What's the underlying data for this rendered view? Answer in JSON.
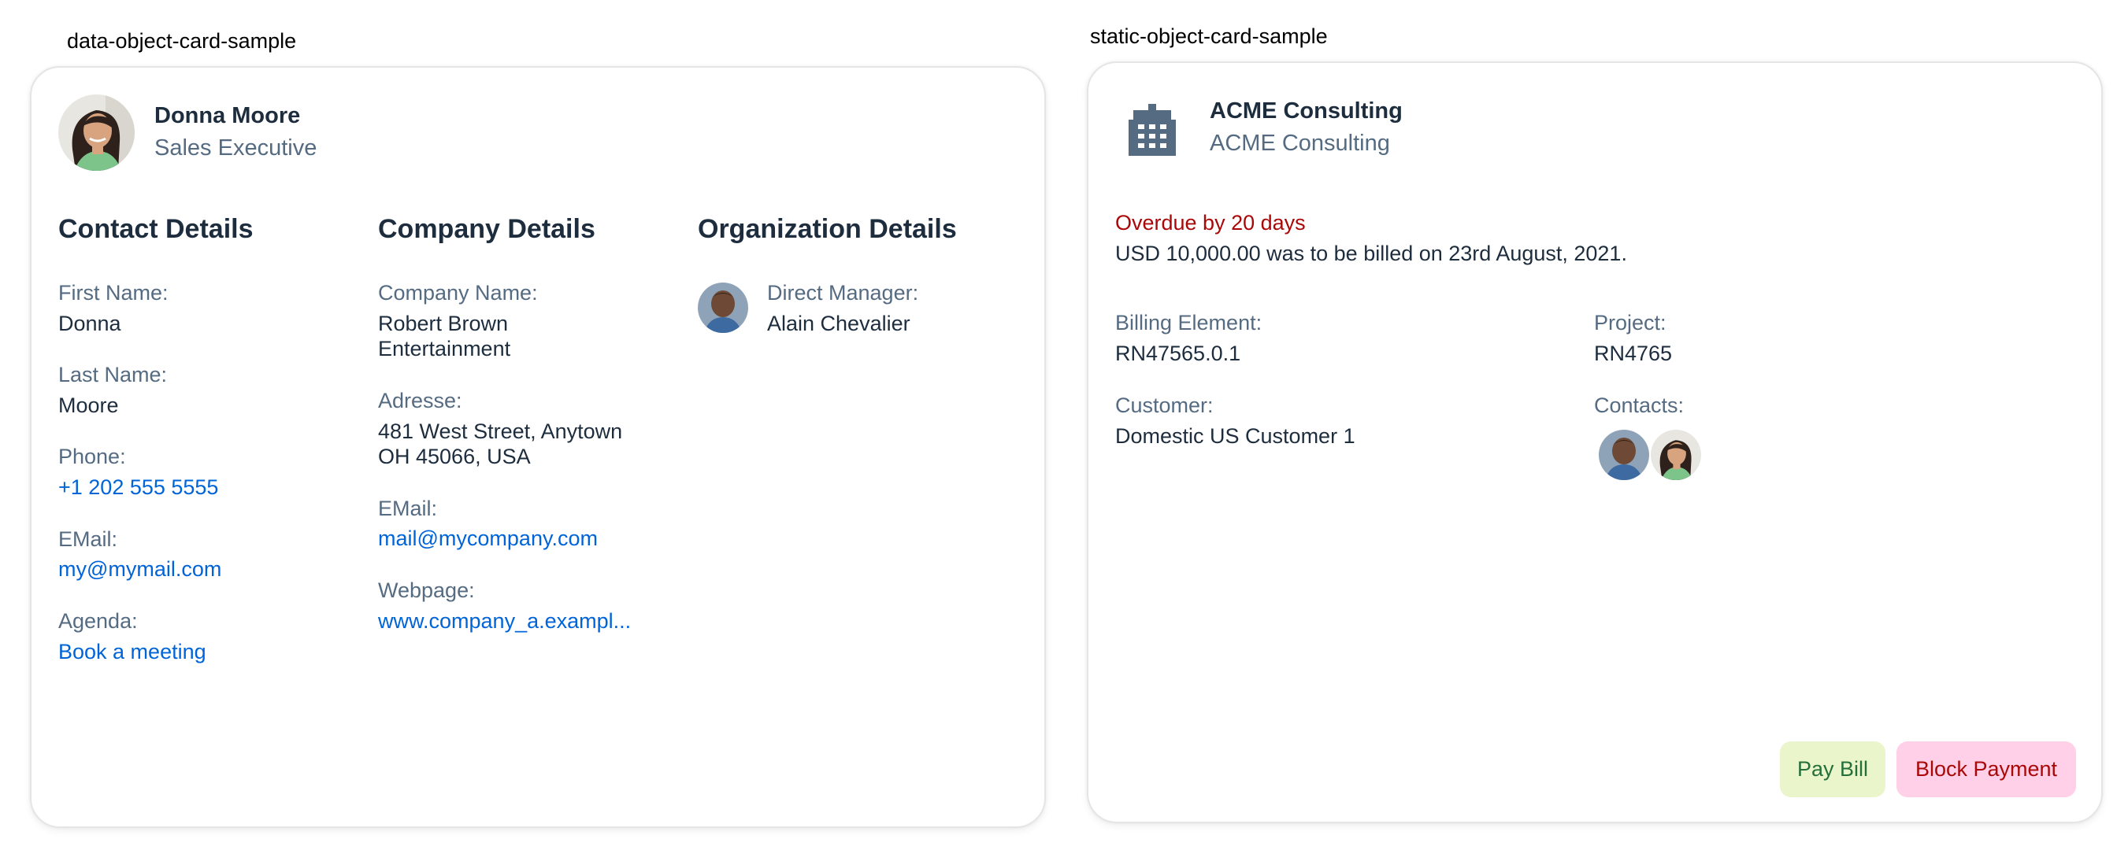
{
  "left_card": {
    "sample_label": "data-object-card-sample",
    "header": {
      "title": "Donna Moore",
      "subtitle": "Sales Executive"
    },
    "contact": {
      "heading": "Contact Details",
      "first_name_label": "First Name:",
      "first_name": "Donna",
      "last_name_label": "Last Name:",
      "last_name": "Moore",
      "phone_label": "Phone:",
      "phone": "+1 202 555 5555",
      "email_label": "EMail:",
      "email": "my@mymail.com",
      "agenda_label": "Agenda:",
      "agenda": "Book a meeting"
    },
    "company": {
      "heading": "Company Details",
      "name_label": "Company Name:",
      "name_line1": "Robert Brown",
      "name_line2": "Entertainment",
      "address_label": "Adresse:",
      "address_line1": "481 West Street, Anytown",
      "address_line2": "OH 45066, USA",
      "email_label": "EMail:",
      "email": "mail@mycompany.com",
      "webpage_label": "Webpage:",
      "webpage": "www.company_a.exampl..."
    },
    "organization": {
      "heading": "Organization Details",
      "manager_label": "Direct Manager:",
      "manager": "Alain Chevalier"
    }
  },
  "right_card": {
    "sample_label": "static-object-card-sample",
    "header": {
      "title": "ACME Consulting",
      "subtitle": "ACME Consulting",
      "icon": "building-icon"
    },
    "status": {
      "overdue": "Overdue by 20 days",
      "description": "USD 10,000.00 was to be billed on 23rd August, 2021.",
      "overdue_color": "#aa0808"
    },
    "fields": {
      "billing_label": "Billing Element:",
      "billing": "RN47565.0.1",
      "project_label": "Project:",
      "project": "RN4765",
      "customer_label": "Customer:",
      "customer": "Domestic US Customer 1",
      "contacts_label": "Contacts:"
    },
    "actions": {
      "pay_bill": "Pay Bill",
      "block_payment": "Block Payment",
      "pay_bill_bg": "#ebf5cb",
      "pay_bill_color": "#256f3a",
      "block_payment_bg": "#ffd0e7",
      "block_payment_color": "#aa0808"
    }
  },
  "colors": {
    "link": "#0064d9",
    "label": "#556b82",
    "text": "#1d2d3e"
  }
}
